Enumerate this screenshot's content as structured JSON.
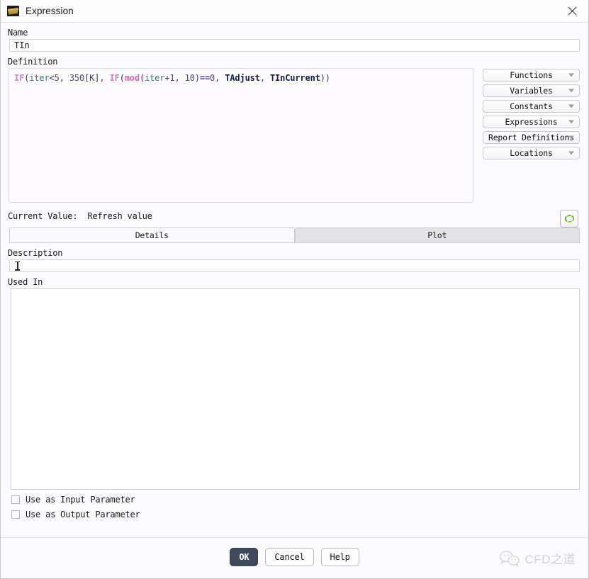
{
  "window": {
    "title": "Expression",
    "icon": "expression-stack-icon",
    "close_label": "×"
  },
  "name_field": {
    "label": "Name",
    "value": "TIn",
    "placeholder": ""
  },
  "definition": {
    "label": "Definition",
    "text": "IF(iter<5, 350[K], IF(mod(iter+1,10)==0, TAdjust, TInCurrent))",
    "tokens": [
      {
        "t": "IF",
        "k": "kw"
      },
      {
        "t": "(",
        "k": "punct"
      },
      {
        "t": "iter",
        "k": "var"
      },
      {
        "t": "<",
        "k": "punct"
      },
      {
        "t": "5",
        "k": "num"
      },
      {
        "t": ", ",
        "k": "punct"
      },
      {
        "t": "350",
        "k": "num"
      },
      {
        "t": "[K]",
        "k": "unit"
      },
      {
        "t": ", ",
        "k": "punct"
      },
      {
        "t": "IF",
        "k": "kw"
      },
      {
        "t": "(",
        "k": "punct"
      },
      {
        "t": "mod",
        "k": "fn"
      },
      {
        "t": "(",
        "k": "punct"
      },
      {
        "t": "iter",
        "k": "var"
      },
      {
        "t": "+",
        "k": "punct"
      },
      {
        "t": "1",
        "k": "num"
      },
      {
        "t": ", ",
        "k": "punct"
      },
      {
        "t": "10",
        "k": "num"
      },
      {
        "t": ")",
        "k": "punct"
      },
      {
        "t": "==",
        "k": "op"
      },
      {
        "t": "0",
        "k": "num"
      },
      {
        "t": ", ",
        "k": "punct"
      },
      {
        "t": "TAdjust",
        "k": "ref"
      },
      {
        "t": ", ",
        "k": "punct"
      },
      {
        "t": "TInCurrent",
        "k": "ref"
      },
      {
        "t": "))",
        "k": "punct"
      }
    ]
  },
  "dropdowns": [
    {
      "label": "Functions"
    },
    {
      "label": "Variables"
    },
    {
      "label": "Constants"
    },
    {
      "label": "Expressions"
    },
    {
      "label": "Report Definitions"
    },
    {
      "label": "Locations"
    }
  ],
  "current_value": {
    "label": "Current Value:",
    "value": "Refresh value",
    "refresh_icon": "refresh-icon"
  },
  "tabs": [
    {
      "label": "Details",
      "active": true
    },
    {
      "label": "Plot",
      "active": false
    }
  ],
  "description": {
    "label": "Description",
    "value": "",
    "placeholder": ""
  },
  "used_in": {
    "label": "Used In",
    "items": []
  },
  "checkboxes": [
    {
      "label": "Use as Input Parameter",
      "checked": false
    },
    {
      "label": "Use as Output Parameter",
      "checked": false
    }
  ],
  "footer_buttons": [
    {
      "label": "OK",
      "style": "primary"
    },
    {
      "label": "Cancel",
      "style": "normal"
    },
    {
      "label": "Help",
      "style": "normal"
    }
  ],
  "watermark": {
    "text": "CFD之道",
    "icon": "wechat-icon"
  },
  "colors": {
    "keyword": "#e87ccd",
    "function": "#e05fb9",
    "variable": "#2a7f8a",
    "reference": "#13204e",
    "number": "#4a4a8c",
    "primary_button": "#414a5c",
    "refresh_green": "#5aab28"
  }
}
